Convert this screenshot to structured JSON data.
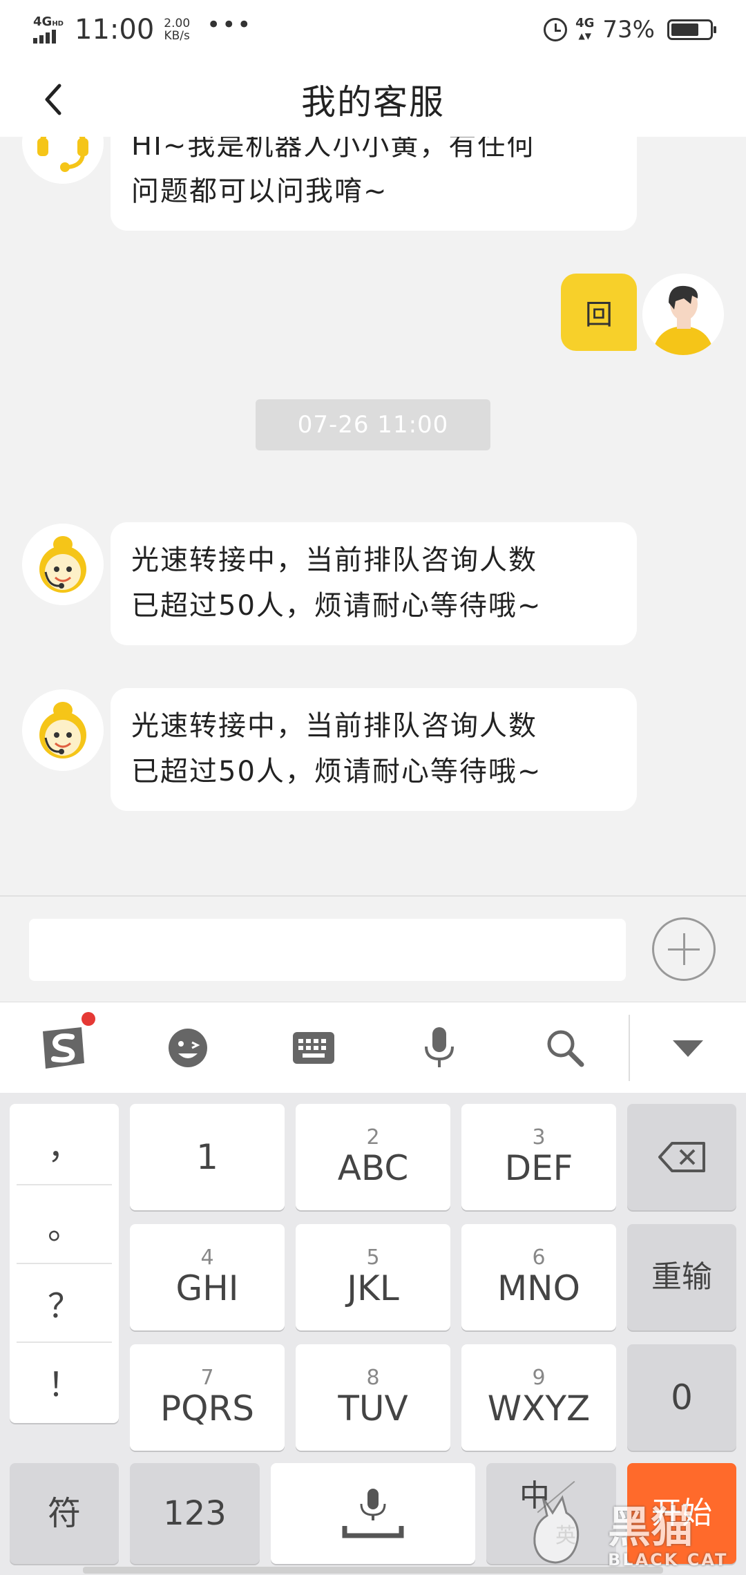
{
  "status_bar": {
    "network": "4G",
    "network_sup": "HD",
    "time": "11:00",
    "speed_value": "2.00",
    "speed_unit": "KB/s",
    "more": "•••",
    "network_right": "4G",
    "battery_percent": "73%",
    "battery_level": 0.73
  },
  "header": {
    "title": "我的客服"
  },
  "chat": {
    "bot_greeting": {
      "line1": "HI~我是机器人小小黄，有任何",
      "line2": "问题都可以问我唷~"
    },
    "user_message": "回",
    "timestamp": "07-26 11:00",
    "agent_messages": [
      {
        "line1": "光速转接中，当前排队咨询人数",
        "line2": "已超过50人，烦请耐心等待哦~"
      },
      {
        "line1": "光速转接中，当前排队咨询人数",
        "line2": "已超过50人，烦请耐心等待哦~"
      }
    ]
  },
  "input_bar": {
    "value": "",
    "placeholder": ""
  },
  "keyboard": {
    "toolbar": [
      "sogou-logo-icon",
      "emoji-icon",
      "keyboard-icon",
      "microphone-icon",
      "search-icon",
      "collapse-icon"
    ],
    "punctuation": [
      "，",
      "。",
      "？",
      "！"
    ],
    "keys": [
      {
        "num": "",
        "main": "1"
      },
      {
        "num": "2",
        "main": "ABC"
      },
      {
        "num": "3",
        "main": "DEF"
      },
      {
        "num": "4",
        "main": "GHI"
      },
      {
        "num": "5",
        "main": "JKL"
      },
      {
        "num": "6",
        "main": "MNO"
      },
      {
        "num": "7",
        "main": "PQRS"
      },
      {
        "num": "8",
        "main": "TUV"
      },
      {
        "num": "9",
        "main": "WXYZ"
      }
    ],
    "reset_label": "重输",
    "zero_label": "0",
    "symbol_label": "符",
    "num123_label": "123",
    "lang_main": "中",
    "lang_sub": "英",
    "start_label": "开始"
  },
  "watermark": {
    "text_cn": "黑猫",
    "text_en": "BLACK CAT"
  },
  "colors": {
    "accent_yellow": "#f7d02a",
    "start_orange": "#ff6a2b",
    "background": "#f2f2f2"
  }
}
